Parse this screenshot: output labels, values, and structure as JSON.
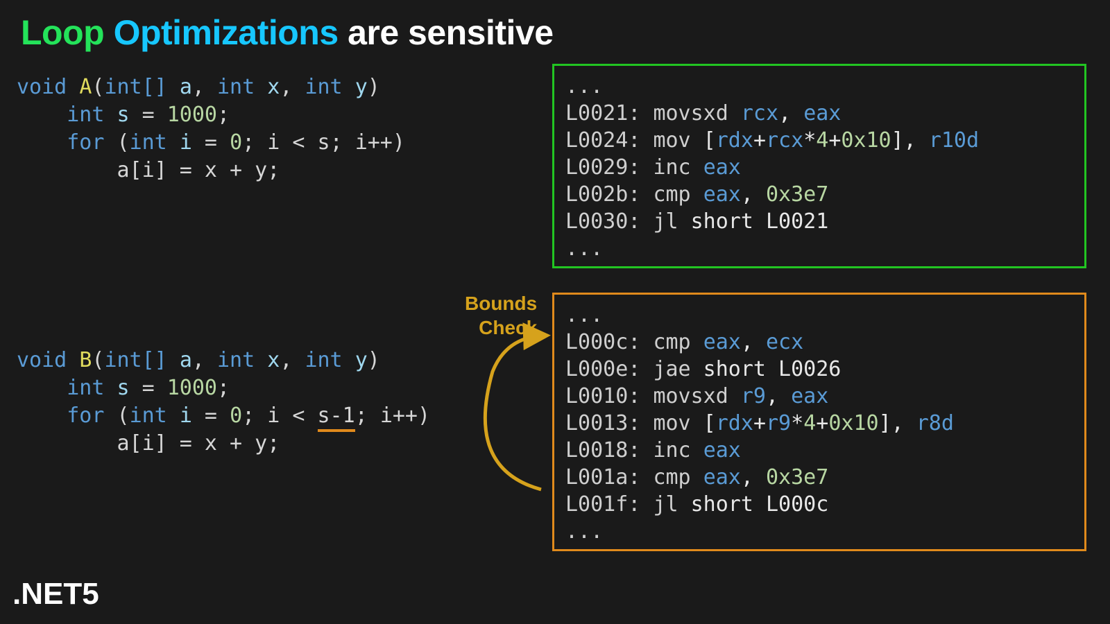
{
  "title": {
    "w1": "Loop",
    "w2": "Optimizations",
    "w3": "are sensitive"
  },
  "footer": ".NET5",
  "boundsCheck": {
    "l1": "Bounds",
    "l2": "Check"
  },
  "colors": {
    "green": "#22c522",
    "orange": "#e08a1c",
    "accentBlue": "#17c7ff",
    "accentGreen": "#24e35a"
  },
  "codeA": {
    "fn": "A",
    "sig_prefix": "void ",
    "sig_params_open": "(",
    "sig_close": ")",
    "p_type": "int",
    "arr_type": "int[]",
    "p_a": "a",
    "p_x": "x",
    "p_y": "y",
    "s_decl": {
      "kw": "int",
      "name": "s",
      "val": "1000"
    },
    "for_kw": "for",
    "i_decl": {
      "kw": "int",
      "name": "i",
      "init": "0"
    },
    "cond": "i < s",
    "inc": "i++",
    "body": "a[i] = x + y;"
  },
  "codeB": {
    "fn": "B",
    "sig_prefix": "void ",
    "sig_close": ")",
    "p_type": "int",
    "arr_type": "int[]",
    "p_a": "a",
    "p_x": "x",
    "p_y": "y",
    "s_decl": {
      "kw": "int",
      "name": "s",
      "val": "1000"
    },
    "for_kw": "for",
    "i_decl": {
      "kw": "int",
      "name": "i",
      "init": "0"
    },
    "cond_pre": "i < ",
    "cond_hl": "s-1",
    "inc": "i++",
    "body": "a[i] = x + y;"
  },
  "asmA": {
    "ellipsis": "...",
    "lines": [
      {
        "lbl": "L0021:",
        "instr": "movsxd",
        "args": [
          [
            "reg",
            "rcx"
          ],
          [
            "txt",
            ", "
          ],
          [
            "reg",
            "eax"
          ]
        ]
      },
      {
        "lbl": "L0024:",
        "instr": "mov",
        "args": [
          [
            "txt",
            "["
          ],
          [
            "reg",
            "rdx"
          ],
          [
            "txt",
            "+"
          ],
          [
            "reg",
            "rcx"
          ],
          [
            "txt",
            "*"
          ],
          [
            "num",
            "4"
          ],
          [
            "txt",
            "+"
          ],
          [
            "num",
            "0x10"
          ],
          [
            "txt",
            "], "
          ],
          [
            "reg",
            "r10d"
          ]
        ]
      },
      {
        "lbl": "L0029:",
        "instr": "inc",
        "args": [
          [
            "reg",
            "eax"
          ]
        ]
      },
      {
        "lbl": "L002b:",
        "instr": "cmp",
        "args": [
          [
            "reg",
            "eax"
          ],
          [
            "txt",
            ", "
          ],
          [
            "num",
            "0x3e7"
          ]
        ]
      },
      {
        "lbl": "L0030:",
        "instr": "jl",
        "args": [
          [
            "txt",
            "short L0021"
          ]
        ]
      }
    ]
  },
  "asmB": {
    "ellipsis": "...",
    "lines": [
      {
        "lbl": "L000c:",
        "instr": "cmp",
        "args": [
          [
            "reg",
            "eax"
          ],
          [
            "txt",
            ", "
          ],
          [
            "reg",
            "ecx"
          ]
        ]
      },
      {
        "lbl": "L000e:",
        "instr": "jae",
        "args": [
          [
            "txt",
            "short L0026"
          ]
        ]
      },
      {
        "lbl": "L0010:",
        "instr": "movsxd",
        "args": [
          [
            "reg",
            "r9"
          ],
          [
            "txt",
            ", "
          ],
          [
            "reg",
            "eax"
          ]
        ]
      },
      {
        "lbl": "L0013:",
        "instr": "mov",
        "args": [
          [
            "txt",
            "["
          ],
          [
            "reg",
            "rdx"
          ],
          [
            "txt",
            "+"
          ],
          [
            "reg",
            "r9"
          ],
          [
            "txt",
            "*"
          ],
          [
            "num",
            "4"
          ],
          [
            "txt",
            "+"
          ],
          [
            "num",
            "0x10"
          ],
          [
            "txt",
            "], "
          ],
          [
            "reg",
            "r8d"
          ]
        ]
      },
      {
        "lbl": "L0018:",
        "instr": "inc",
        "args": [
          [
            "reg",
            "eax"
          ]
        ]
      },
      {
        "lbl": "L001a:",
        "instr": "cmp",
        "args": [
          [
            "reg",
            "eax"
          ],
          [
            "txt",
            ", "
          ],
          [
            "num",
            "0x3e7"
          ]
        ]
      },
      {
        "lbl": "L001f:",
        "instr": "jl",
        "args": [
          [
            "txt",
            "short L000c"
          ]
        ]
      }
    ]
  }
}
